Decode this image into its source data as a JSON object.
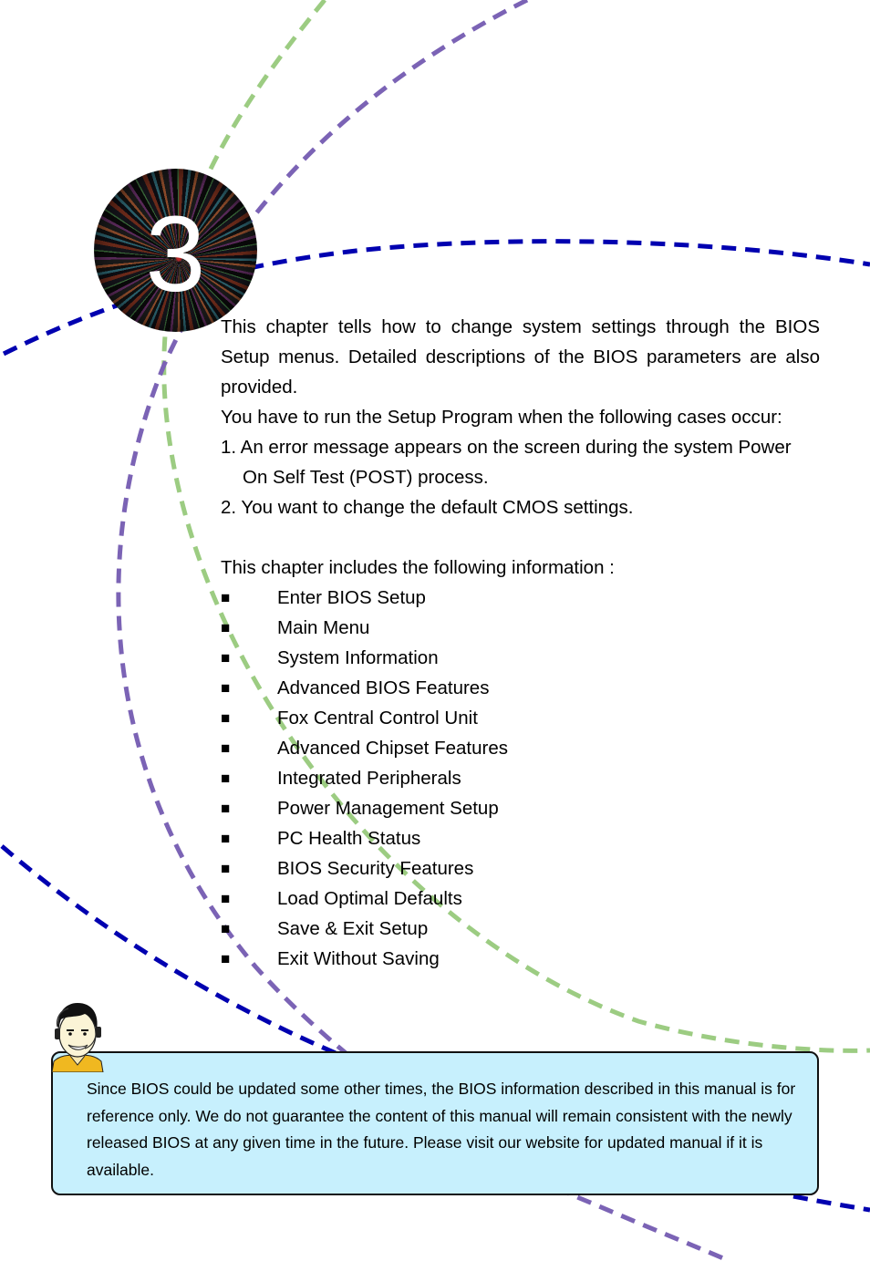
{
  "chapter": {
    "number": "3",
    "badge_icon": "starburst-chapter-badge-icon"
  },
  "intro": {
    "paragraph1": "This chapter tells how to change system settings through the BIOS Setup menus. Detailed descriptions of the BIOS parameters are also provided.",
    "paragraph2": "You have to run the Setup Program when the following cases occur:",
    "cases": [
      "1. An error message appears on the screen during the system Power On Self Test (POST) process.",
      "2. You want to change the default CMOS settings."
    ],
    "includes_heading": "This chapter includes the following information :"
  },
  "topics": {
    "bullet_glyph": "■",
    "items": [
      "Enter BIOS Setup",
      "Main Menu",
      "System Information",
      "Advanced BIOS Features",
      "Fox Central Control Unit",
      "Advanced Chipset Features",
      "Integrated Peripherals",
      "Power Management Setup",
      "PC Health Status",
      "BIOS Security Features",
      "Load Optimal Defaults",
      "Save & Exit Setup",
      "Exit Without Saving"
    ]
  },
  "note": {
    "icon": "support-agent-headset-icon",
    "text": "Since BIOS could be updated some other times, the BIOS information described in this manual is for reference only. We do not guarantee the content of this manual will remain consistent with the newly released BIOS at any given time in the future. Please visit our website for updated manual if it is available."
  },
  "colors": {
    "curve_green": "#9ccc82",
    "curve_purple": "#7b63b5",
    "curve_blue": "#0000b0",
    "note_background": "#c7f0fd",
    "note_border": "#111111"
  }
}
